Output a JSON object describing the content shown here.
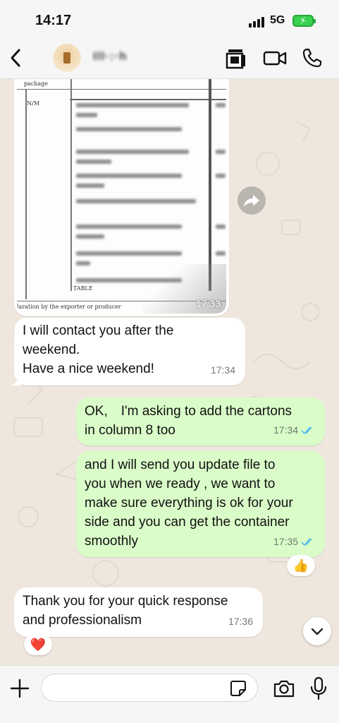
{
  "status_bar": {
    "time": "14:17",
    "network": "5G",
    "battery_icon": "battery-charging-icon"
  },
  "header": {
    "back_icon": "chevron-left-icon",
    "contact_name": "Ill·:·h",
    "icons": [
      "contact-card-icon",
      "video-call-icon",
      "phone-call-icon"
    ]
  },
  "colors": {
    "incoming": "#ffffff",
    "outgoing": "#dafcc9",
    "accent_ticks": "#53bdeb",
    "background": "#efe7dd"
  },
  "messages": [
    {
      "type": "image",
      "direction": "in",
      "time": "17:33",
      "doc_text": {
        "top": "package",
        "left_code": "N/M",
        "table_label": "TABLE",
        "footer": "laration by the exporter or producer"
      }
    },
    {
      "type": "text",
      "direction": "in",
      "text": "I will contact you after the\nweekend.\nHave a nice weekend!",
      "time": "17:34"
    },
    {
      "type": "text",
      "direction": "out",
      "text": "OK,　I'm asking to add the cartons\nin column 8 too",
      "time": "17:34",
      "status": "read"
    },
    {
      "type": "text",
      "direction": "out",
      "text": "and I will send you update file to\nyou when we ready , we want to\nmake sure everything is ok for your\nside and you can get the container\nsmoothly",
      "time": "17:35",
      "status": "read",
      "reaction": "👍"
    },
    {
      "type": "text",
      "direction": "in",
      "text": "Thank you for your quick response\nand professionalism",
      "time": "17:36",
      "reaction": "❤️"
    }
  ],
  "composer": {
    "placeholder": "",
    "value": ""
  }
}
